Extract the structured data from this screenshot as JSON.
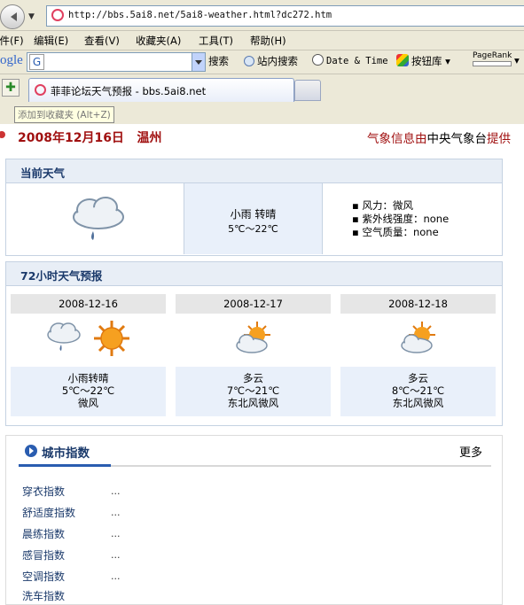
{
  "browser": {
    "url": "http://bbs.5ai8.net/5ai8-weather.html?dc272.htm",
    "menu": [
      "文件(F)",
      "编辑(E)",
      "查看(V)",
      "收藏夹(A)",
      "工具(T)",
      "帮助(H)"
    ],
    "google_logo": "ogle",
    "google_g": "G",
    "toolbar": {
      "search": "搜索",
      "site_search": "站内搜索",
      "date_time": "Date & Time",
      "button_lib": "按钮库",
      "pagerank": "PageRank"
    },
    "tab_title": "菲菲论坛天气预报 - bbs.5ai8.net",
    "tooltip": "添加到收藏夹 (Alt+Z)"
  },
  "page": {
    "date_city": "2008年12月16日   温州",
    "source_prefix": "气象信息由",
    "source_org": "中央气象台",
    "source_suffix": "提供"
  },
  "current": {
    "title": "当前天气",
    "condition": "小雨 转晴",
    "temp": "5℃～22℃",
    "wind": "风力：微风",
    "uv": "紫外线强度：none",
    "air": "空气质量：none"
  },
  "forecast": {
    "title": "72小时天气预报",
    "days": [
      {
        "date": "2008-12-16",
        "cond": "小雨转晴",
        "temp": "5℃～22℃",
        "wind": "微风",
        "icons": [
          "rain-cloud-icon",
          "sun-icon"
        ]
      },
      {
        "date": "2008-12-17",
        "cond": "多云",
        "temp": "7℃～21℃",
        "wind": "东北风微风",
        "icons": [
          "partly-cloudy-icon"
        ]
      },
      {
        "date": "2008-12-18",
        "cond": "多云",
        "temp": "8℃～21℃",
        "wind": "东北风微风",
        "icons": [
          "partly-cloudy-icon"
        ]
      }
    ]
  },
  "city_index": {
    "title": "城市指数",
    "more": "更多",
    "items": [
      "穿衣指数",
      "舒适度指数",
      "晨练指数",
      "感冒指数",
      "空调指数",
      "洗车指数"
    ],
    "item_value": "..."
  },
  "colors": {
    "accent": "#a01010",
    "panel_head": "#e8eef6",
    "title": "#1b3a6b"
  }
}
